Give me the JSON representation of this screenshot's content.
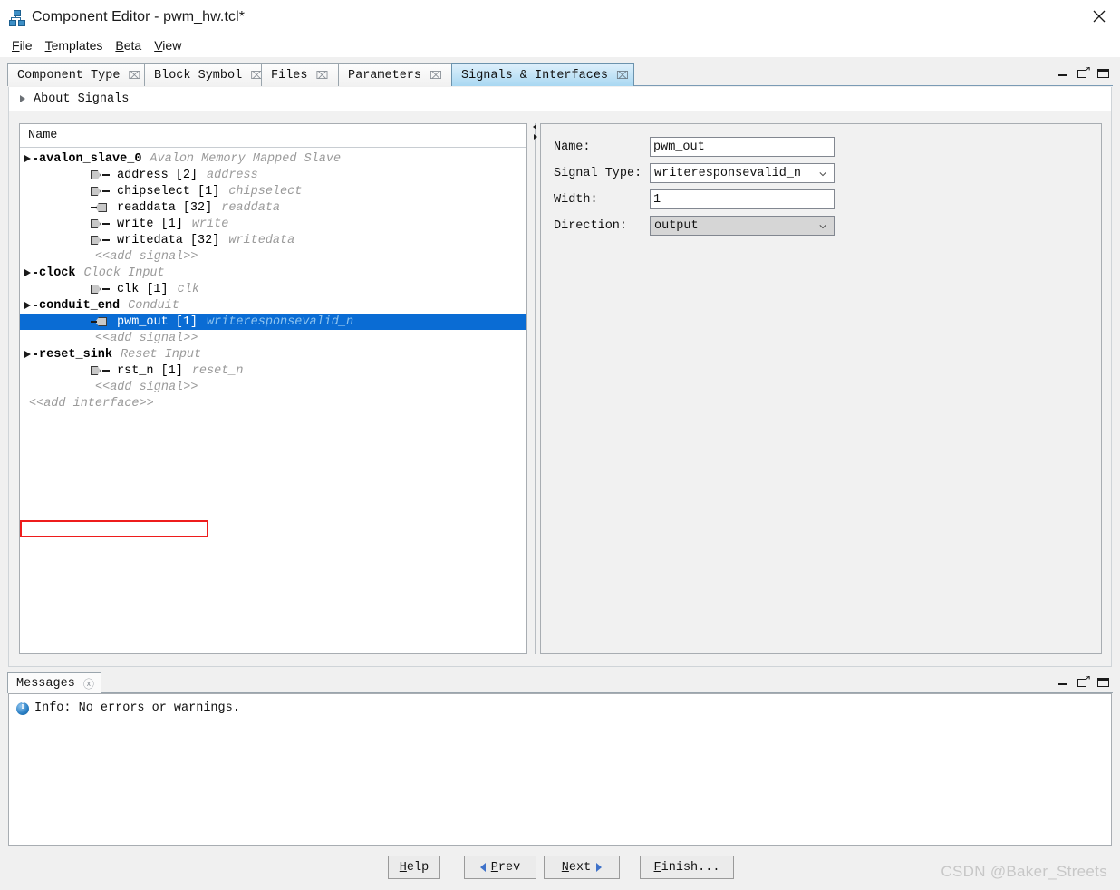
{
  "window": {
    "title": "Component Editor - pwm_hw.tcl*",
    "app_icon": "hierarchy-icon",
    "close_icon": "close-icon"
  },
  "menu": [
    {
      "label": "File",
      "mnemonic": "F"
    },
    {
      "label": "Templates",
      "mnemonic": "T"
    },
    {
      "label": "Beta",
      "mnemonic": "B"
    },
    {
      "label": "View",
      "mnemonic": "V"
    }
  ],
  "tabs": [
    {
      "label": "Component Type",
      "active": false,
      "close_icon": "tab-close-icon"
    },
    {
      "label": "Block Symbol",
      "active": false,
      "close_icon": "tab-close-icon"
    },
    {
      "label": "Files",
      "active": false,
      "close_icon": "tab-close-icon"
    },
    {
      "label": "Parameters",
      "active": false,
      "close_icon": "tab-close-icon"
    },
    {
      "label": "Signals & Interfaces",
      "active": true,
      "close_icon": "tab-close-icon"
    }
  ],
  "panel_controls": {
    "minimize_icon": "minimize-icon",
    "float_icon": "float-restore-icon",
    "maximize_icon": "maximize-icon"
  },
  "about": {
    "label": "About Signals",
    "expander_icon": "chevron-right-icon",
    "expanded": false
  },
  "tree": {
    "column_header": "Name",
    "rows": [
      {
        "kind": "interface",
        "name": "avalon_slave_0",
        "type": "Avalon Memory Mapped Slave",
        "icon": "expander-triangle-icon"
      },
      {
        "kind": "signal",
        "name": "address",
        "width": "[2]",
        "signal_type": "address",
        "direction": "input",
        "icon": "input-port-icon"
      },
      {
        "kind": "signal",
        "name": "chipselect",
        "width": "[1]",
        "signal_type": "chipselect",
        "direction": "input",
        "icon": "input-port-icon"
      },
      {
        "kind": "signal",
        "name": "readdata",
        "width": "[32]",
        "signal_type": "readdata",
        "direction": "output",
        "icon": "output-port-icon"
      },
      {
        "kind": "signal",
        "name": "write",
        "width": "[1]",
        "signal_type": "write",
        "direction": "input",
        "icon": "input-port-icon"
      },
      {
        "kind": "signal",
        "name": "writedata",
        "width": "[32]",
        "signal_type": "writedata",
        "direction": "input",
        "icon": "input-port-icon"
      },
      {
        "kind": "add-signal",
        "name": "<<add signal>>"
      },
      {
        "kind": "interface",
        "name": "clock",
        "type": "Clock Input",
        "icon": "expander-triangle-icon"
      },
      {
        "kind": "signal",
        "name": "clk",
        "width": "[1]",
        "signal_type": "clk",
        "direction": "input",
        "icon": "input-port-icon"
      },
      {
        "kind": "interface",
        "name": "conduit_end",
        "type": "Conduit",
        "icon": "expander-triangle-icon"
      },
      {
        "kind": "signal",
        "name": "pwm_out",
        "width": "[1]",
        "signal_type": "writeresponsevalid_n",
        "direction": "output",
        "icon": "output-port-icon",
        "selected": true
      },
      {
        "kind": "add-signal",
        "name": "<<add signal>>"
      },
      {
        "kind": "interface",
        "name": "reset_sink",
        "type": "Reset Input",
        "icon": "expander-triangle-icon"
      },
      {
        "kind": "signal",
        "name": "rst_n",
        "width": "[1]",
        "signal_type": "reset_n",
        "direction": "input",
        "icon": "input-port-icon"
      },
      {
        "kind": "add-signal",
        "name": "<<add signal>>"
      },
      {
        "kind": "add-interface",
        "name": "<<add interface>>",
        "highlighted": true
      }
    ],
    "highlight_color": "#ee1c1c",
    "selection_color": "#0a6cd4"
  },
  "form": {
    "name_label": "Name:",
    "name_value": "pwm_out",
    "signal_type_label": "Signal Type:",
    "signal_type_value": "writeresponsevalid_n",
    "width_label": "Width:",
    "width_value": "1",
    "direction_label": "Direction:",
    "direction_value": "output",
    "direction_disabled": true,
    "dropdown_icon": "chevron-down-icon"
  },
  "messages": {
    "tab_label": "Messages",
    "close_icon": "tab-close-icon",
    "info_icon": "info-icon",
    "text": "Info: No errors or warnings."
  },
  "buttons": [
    {
      "label": "Help",
      "mnemonic": "H",
      "icon": null
    },
    {
      "label": "Prev",
      "mnemonic": "P",
      "icon": "arrow-left-icon"
    },
    {
      "label": "Next",
      "mnemonic": "N",
      "icon": "arrow-right-icon"
    },
    {
      "label": "Finish...",
      "mnemonic": "F",
      "icon": null
    }
  ],
  "watermark": "CSDN @Baker_Streets"
}
